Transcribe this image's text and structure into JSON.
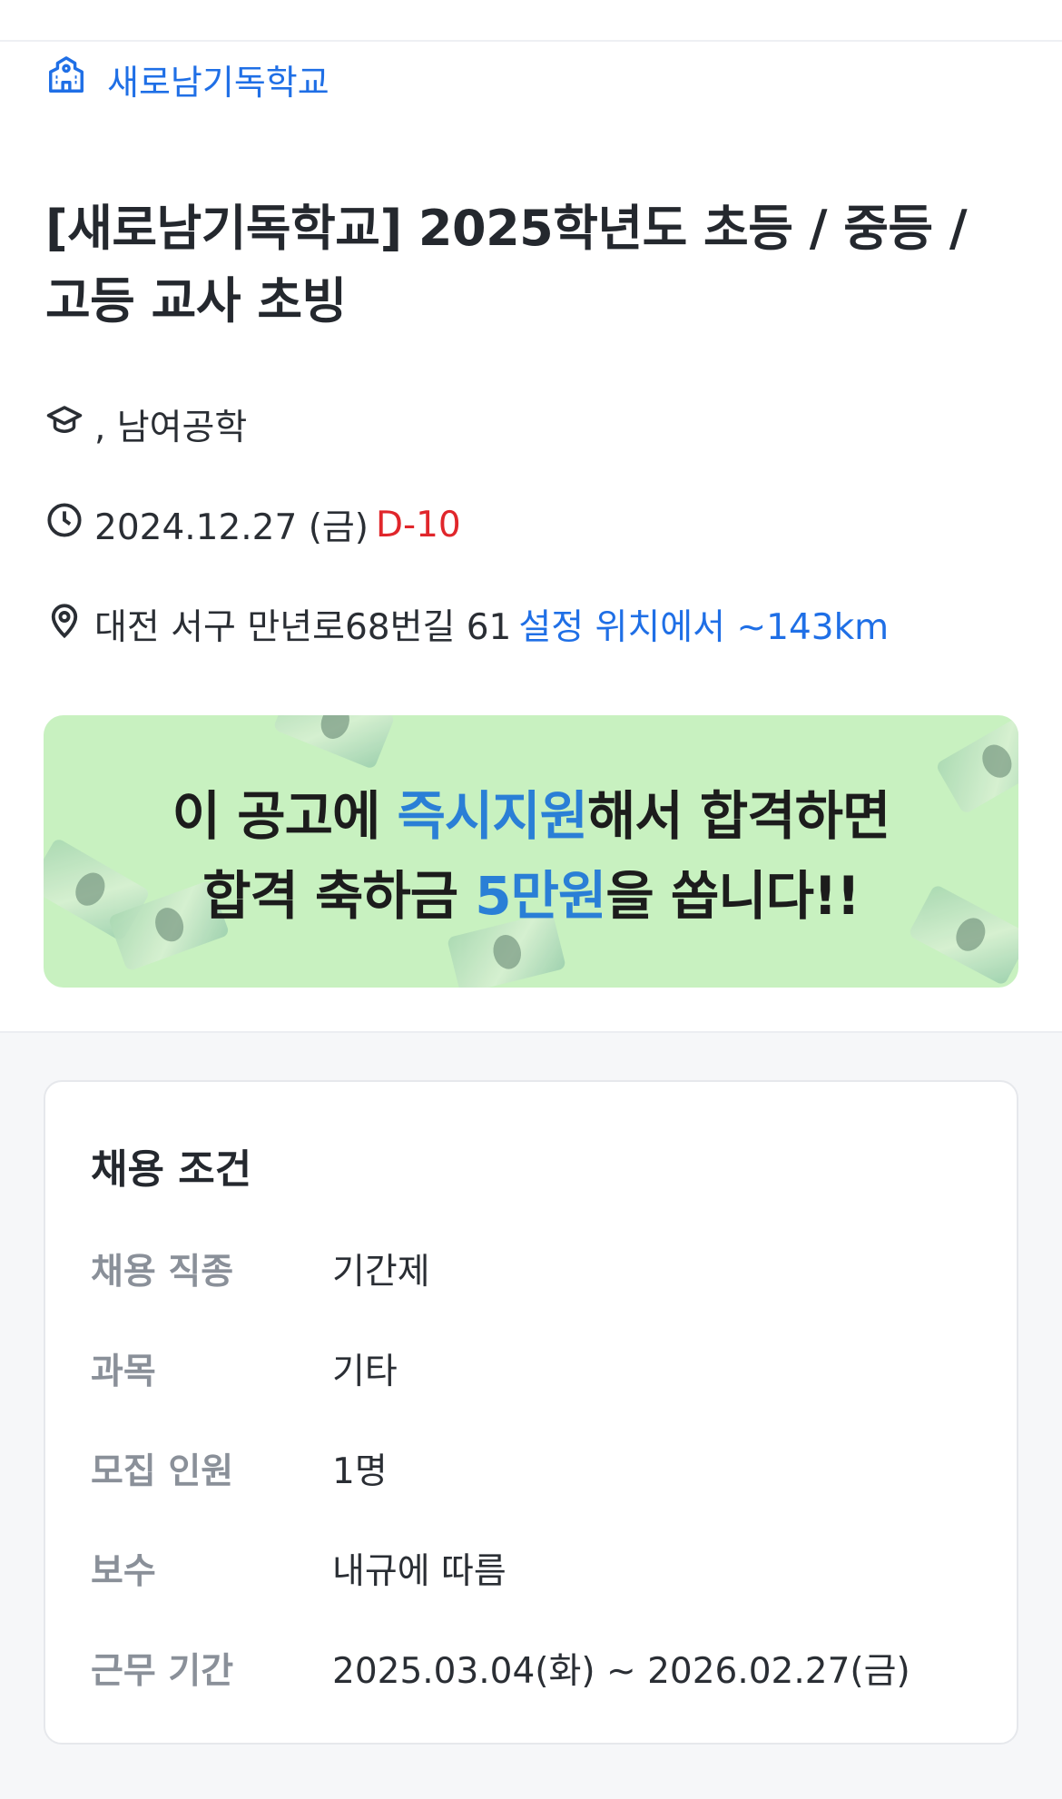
{
  "school": {
    "name": "새로남기독학교",
    "icon": "school-building-icon"
  },
  "title": "[새로남기독학교] 2025학년도 초등 / 중등 / 고등 교사 초빙",
  "meta": {
    "level_text": ", 남여공학",
    "deadline_date": "2024.12.27 (금)",
    "d_day": "D-10",
    "address": "대전 서구 만년로68번길 61",
    "distance": "설정 위치에서 ~143km"
  },
  "banner": {
    "line1_a": "이 공고에 ",
    "line1_hl": "즉시지원",
    "line1_b": "해서 합격하면",
    "line2_a": "합격 축하금 ",
    "line2_hl": "5만원",
    "line2_b": "을 쏩니다!!"
  },
  "conditions": {
    "title": "채용 조건",
    "rows": [
      {
        "label": "채용 직종",
        "value": "기간제"
      },
      {
        "label": "과목",
        "value": "기타"
      },
      {
        "label": "모집 인원",
        "value": "1명"
      },
      {
        "label": "보수",
        "value": "내규에 따름"
      },
      {
        "label": "근무 기간",
        "value": "2025.03.04(화) ~ 2026.02.27(금)"
      }
    ]
  },
  "colors": {
    "accent": "#1f6fe6",
    "deadline_red": "#e0262b",
    "banner_bg": "#c8f1c0",
    "banner_highlight": "#2a7fd6"
  }
}
